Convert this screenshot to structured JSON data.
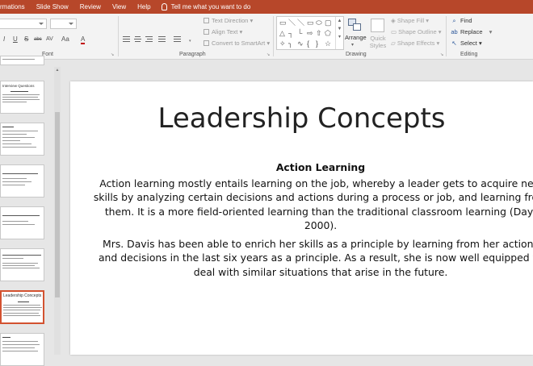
{
  "tabs": [
    "rmations",
    "Slide Show",
    "Review",
    "View",
    "Help"
  ],
  "tell_me": "Tell me what you want to do",
  "ribbon": {
    "font_group_label": "Font",
    "font_buttons": [
      "I",
      "U",
      "S",
      "abc",
      "AV",
      "Aa",
      "A"
    ],
    "paragraph_group_label": "Paragraph",
    "text_direction": "Text Direction",
    "align_text": "Align Text",
    "convert_smartart": "Convert to SmartArt",
    "drawing_group_label": "Drawing",
    "arrange": "Arrange",
    "quick_styles": "Quick Styles",
    "shape_fill": "Shape Fill",
    "shape_outline": "Shape Outline",
    "shape_effects": "Shape Effects",
    "editing_group_label": "Editing",
    "find": "Find",
    "replace": "Replace",
    "select": "Select"
  },
  "thumbnails": [
    {
      "title": ""
    },
    {
      "title": "Interview Questions"
    },
    {
      "title": ""
    },
    {
      "title": ""
    },
    {
      "title": ""
    },
    {
      "title": ""
    },
    {
      "title": "Leadership Concepts"
    },
    {
      "title": ""
    }
  ],
  "slide": {
    "title": "Leadership Concepts",
    "heading": "Action Learning",
    "paragraph1": "Action learning mostly entails learning on the job, whereby a leader gets to acquire new skills by analyzing certain decisions and actions during a process or job, and learning from them. It is a more field-oriented learning than the traditional classroom learning (Day, 2000).",
    "paragraph2": "Mrs. Davis has been able to enrich her skills as a principle by learning from her actions and decisions in the last six years as a principle. As a result, she is now well equipped to deal with similar situations that arise in the future."
  },
  "colors": {
    "tab_bar": "#b7472a",
    "selected_thumb_border": "#d35230"
  }
}
